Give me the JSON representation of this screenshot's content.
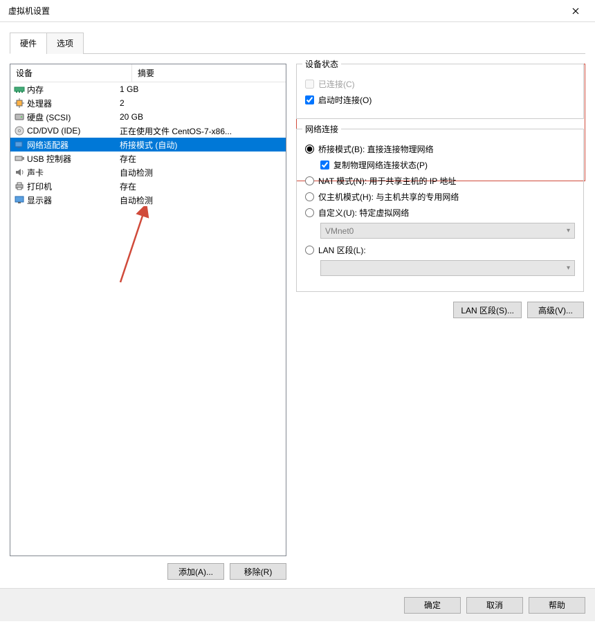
{
  "window": {
    "title": "虚拟机设置"
  },
  "tabs": {
    "hardware": "硬件",
    "options": "选项"
  },
  "list": {
    "header": {
      "device": "设备",
      "summary": "摘要"
    },
    "rows": [
      {
        "icon": "memory-icon",
        "name": "内存",
        "summary": "1 GB"
      },
      {
        "icon": "cpu-icon",
        "name": "处理器",
        "summary": "2"
      },
      {
        "icon": "disk-icon",
        "name": "硬盘 (SCSI)",
        "summary": "20 GB"
      },
      {
        "icon": "cd-icon",
        "name": "CD/DVD (IDE)",
        "summary": "正在使用文件 CentOS-7-x86..."
      },
      {
        "icon": "network-icon",
        "name": "网络适配器",
        "summary": "桥接模式 (自动)"
      },
      {
        "icon": "usb-icon",
        "name": "USB 控制器",
        "summary": "存在"
      },
      {
        "icon": "sound-icon",
        "name": "声卡",
        "summary": "自动检测"
      },
      {
        "icon": "printer-icon",
        "name": "打印机",
        "summary": "存在"
      },
      {
        "icon": "display-icon",
        "name": "显示器",
        "summary": "自动检测"
      }
    ],
    "selectedIndex": 4
  },
  "buttons": {
    "add": "添加(A)...",
    "remove": "移除(R)",
    "lan_segments": "LAN 区段(S)...",
    "advanced": "高级(V)...",
    "ok": "确定",
    "cancel": "取消",
    "help": "帮助"
  },
  "device_state": {
    "title": "设备状态",
    "connected": "已连接(C)",
    "connect_at_start": "启动时连接(O)"
  },
  "network": {
    "title": "网络连接",
    "bridged": "桥接模式(B): 直接连接物理网络",
    "replicate": "复制物理网络连接状态(P)",
    "nat": "NAT 模式(N): 用于共享主机的 IP 地址",
    "hostonly": "仅主机模式(H): 与主机共享的专用网络",
    "custom": "自定义(U): 特定虚拟网络",
    "custom_value": "VMnet0",
    "lan_segment": "LAN 区段(L):",
    "lan_value": ""
  }
}
